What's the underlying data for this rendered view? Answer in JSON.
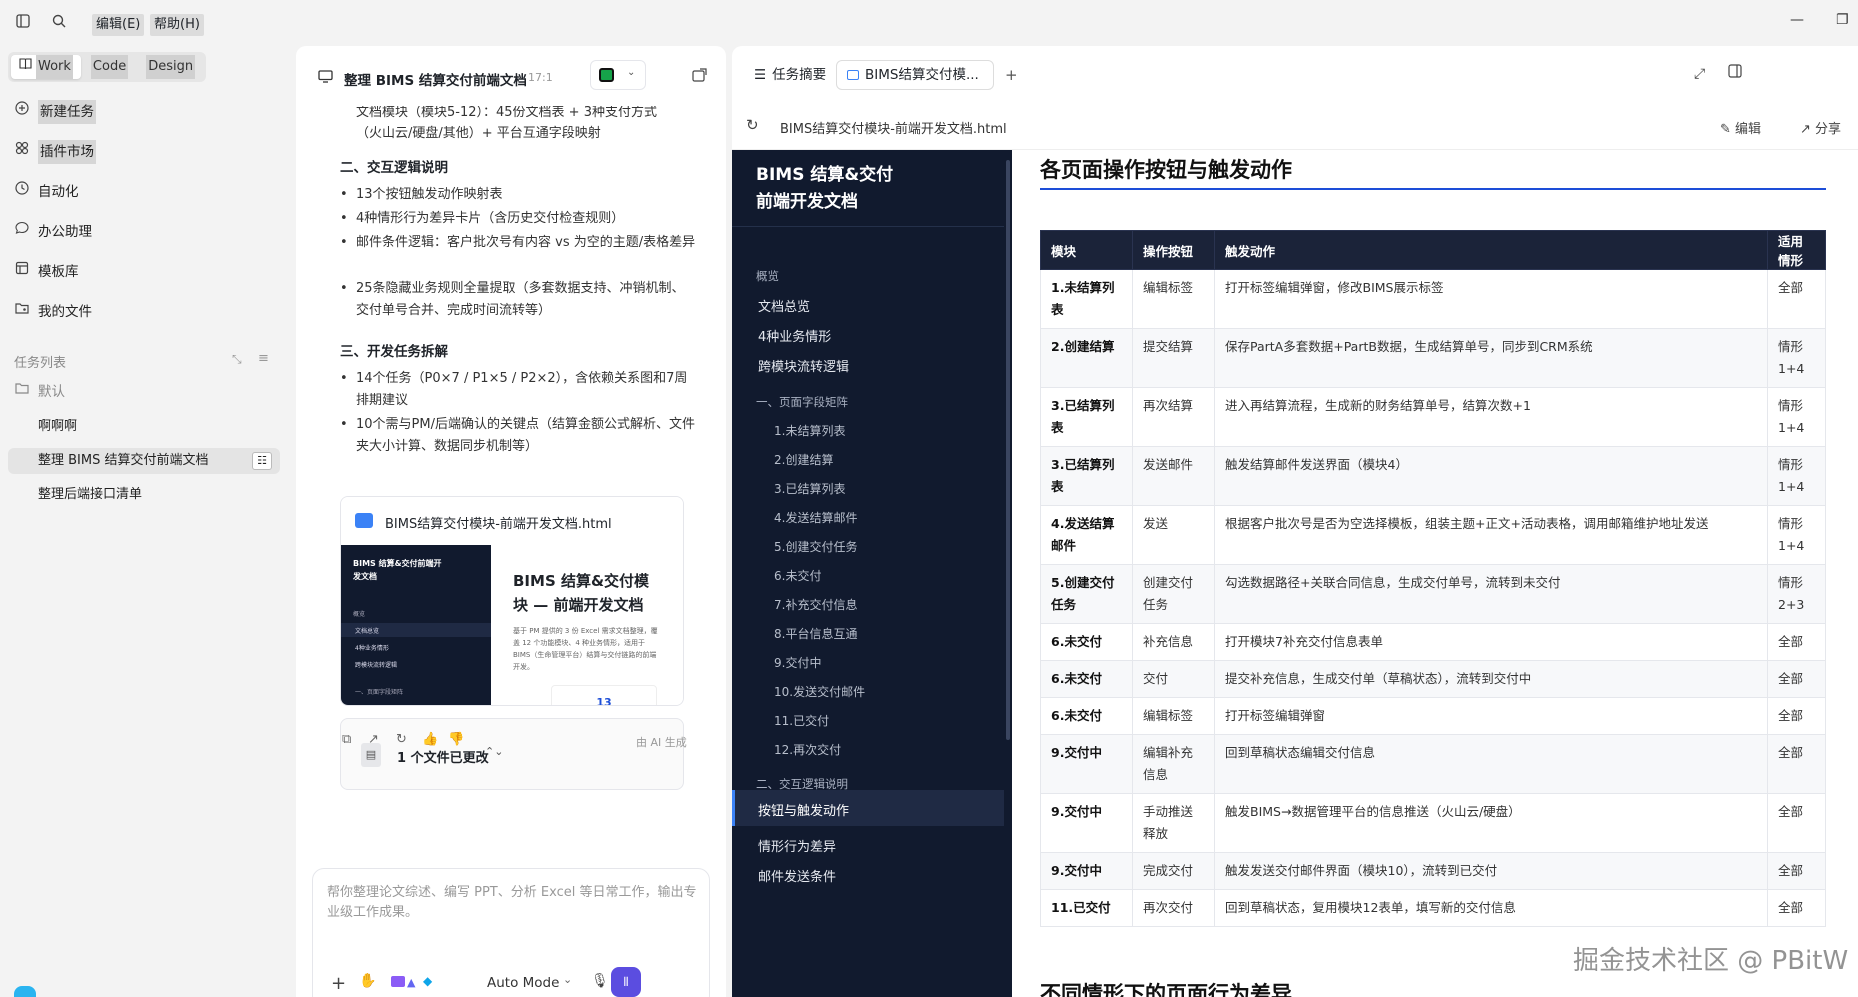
{
  "menu": {
    "edit": "编辑(E)",
    "help": "帮助(H)"
  },
  "sidebar": {
    "modes": [
      "Work",
      "Code",
      "Design"
    ],
    "nav": [
      {
        "label": "新建任务",
        "icon": "plus-circle-icon"
      },
      {
        "label": "插件市场",
        "icon": "plugin-icon"
      },
      {
        "label": "自动化",
        "icon": "clock-icon"
      },
      {
        "label": "办公助理",
        "icon": "chat-bubble-icon"
      },
      {
        "label": "模板库",
        "icon": "template-icon"
      },
      {
        "label": "我的文件",
        "icon": "folder-user-icon"
      }
    ],
    "task_list_title": "任务列表",
    "folder": "默认",
    "tasks": [
      "啊啊啊",
      "整理 BIMS 结算交付前端文档",
      "整理后端接口清单"
    ]
  },
  "chat": {
    "title": "整理 BIMS 结算交付前端文档",
    "time": "17:1",
    "partial_top_line": "文档模块（模块5-12）：45份文档表 + 3种支付方式",
    "partial_top_line2": "（火山云/硬盘/其他）+ 平台互通字段映射",
    "sections": [
      {
        "heading": "二、交互逻辑说明",
        "bullets": [
          "13个按钮触发动作映射表",
          "4种情形行为差异卡片（含历史交付检查规则）",
          "邮件条件逻辑：客户批次号有内容 vs 为空的主题/表格差异",
          "25条隐藏业务规则全量提取（多套数据支持、冲销机制、交付单号合并、完成时间流转等）"
        ]
      },
      {
        "heading": "三、开发任务拆解",
        "bullets": [
          "14个任务（P0×7 / P1×5 / P2×2），含依赖关系图和7周排期建议",
          "10个需与PM/后端确认的关键点（结算金额公式解析、文件夹大小计算、数据同步机制等）"
        ]
      }
    ],
    "file_card": {
      "name": "BIMS结算交付模块-前端开发文档.html",
      "thumb_nav_title": "BIMS 结算&交付前端开发文档",
      "thumb_nav_items": [
        "概览",
        "文档总览",
        "4种业务情形",
        "跨模块流转逻辑",
        "一、页面字段矩阵"
      ],
      "thumb_title": "BIMS 结算&交付模块 — 前端开发文档",
      "thumb_desc": "基于 PM 提供的 3 份 Excel 需求文档整理，覆盖 12 个功能模块、4 种业务情形，适用于 BIMS（生命管理平台）结算与交付链路的前端开发。",
      "thumb_num": "13"
    },
    "changed": "1 个文件已更改",
    "ai_note": "由 AI 生成",
    "composer_placeholder": "帮你整理论文综述、编写 PPT、分析 Excel 等日常工作，输出专业级工作成果。",
    "mode": "Auto Mode"
  },
  "preview": {
    "tabs": [
      "任务摘要",
      "BIMS结算交付模..."
    ],
    "filename": "BIMS结算交付模块-前端开发文档.html",
    "edit": "编辑",
    "share": "分享",
    "doc_title": "BIMS 结算&交付\n前端开发文档",
    "nav": {
      "overview_group": "概览",
      "overview": [
        "文档总览",
        "4种业务情形",
        "跨模块流转逻辑"
      ],
      "group1": "一、页面字段矩阵",
      "group1_items": [
        "1.未结算列表",
        "2.创建结算",
        "3.已结算列表",
        "4.发送结算邮件",
        "5.创建交付任务",
        "6.未交付",
        "7.补充交付信息",
        "8.平台信息互通",
        "9.交付中",
        "10.发送交付邮件",
        "11.已交付",
        "12.再次交付"
      ],
      "group2": "二、交互逻辑说明",
      "group2_items": [
        "按钮与触发动作",
        "情形行为差异",
        "邮件发送条件"
      ]
    },
    "h2": "各页面操作按钮与触发动作",
    "h2_next": "不同情形下的页面行为差异",
    "table": {
      "headers": [
        "模块",
        "操作按钮",
        "触发动作",
        "适用情形"
      ],
      "rows": [
        [
          "1.未结算列表",
          "编辑标签",
          "打开标签编辑弹窗，修改BIMS展示标签",
          "全部"
        ],
        [
          "2.创建结算",
          "提交结算",
          "保存PartA多套数据+PartB数据，生成结算单号，同步到CRM系统",
          "情形1+4"
        ],
        [
          "3.已结算列表",
          "再次结算",
          "进入再结算流程，生成新的财务结算单号，结算次数+1",
          "情形1+4"
        ],
        [
          "3.已结算列表",
          "发送邮件",
          "触发结算邮件发送界面（模块4）",
          "情形1+4"
        ],
        [
          "4.发送结算邮件",
          "发送",
          "根据客户批次号是否为空选择模板，组装主题+正文+活动表格，调用邮箱维护地址发送",
          "情形1+4"
        ],
        [
          "5.创建交付任务",
          "创建交付任务",
          "勾选数据路径+关联合同信息，生成交付单号，流转到未交付",
          "情形2+3"
        ],
        [
          "6.未交付",
          "补充信息",
          "打开模块7补充交付信息表单",
          "全部"
        ],
        [
          "6.未交付",
          "交付",
          "提交补充信息，生成交付单（草稿状态），流转到交付中",
          "全部"
        ],
        [
          "6.未交付",
          "编辑标签",
          "打开标签编辑弹窗",
          "全部"
        ],
        [
          "9.交付中",
          "编辑补充信息",
          "回到草稿状态编辑交付信息",
          "全部"
        ],
        [
          "9.交付中",
          "手动推送释放",
          "触发BIMS→数据管理平台的信息推送（火山云/硬盘）",
          "全部"
        ],
        [
          "9.交付中",
          "完成交付",
          "触发发送交付邮件界面（模块10），流转到已交付",
          "全部"
        ],
        [
          "11.已交付",
          "再次交付",
          "回到草稿状态，复用模块12表单，填写新的交付信息",
          "全部"
        ]
      ]
    }
  },
  "watermark": "掘金技术社区 @ PBitW"
}
